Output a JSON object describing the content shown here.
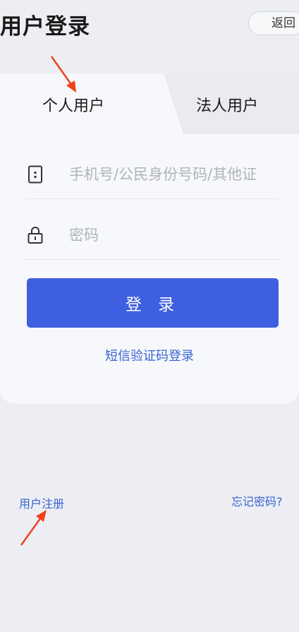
{
  "header": {
    "title": "用户登录",
    "back_label": "返回"
  },
  "tabs": [
    {
      "label": "个人用户",
      "active": true
    },
    {
      "label": "法人用户",
      "active": false
    }
  ],
  "form": {
    "phone_placeholder": "手机号/公民身份号码/其他证",
    "phone_icon": "phone-icon",
    "password_placeholder": "密码",
    "password_icon": "lock-icon",
    "login_label": "登 录",
    "sms_login_label": "短信验证码登录"
  },
  "footer": {
    "register_label": "用户注册",
    "forgot_label": "忘记密码?"
  },
  "colors": {
    "accent": "#3d5fe0",
    "link": "#3a63d3",
    "annotation_arrow": "#f0401c"
  }
}
